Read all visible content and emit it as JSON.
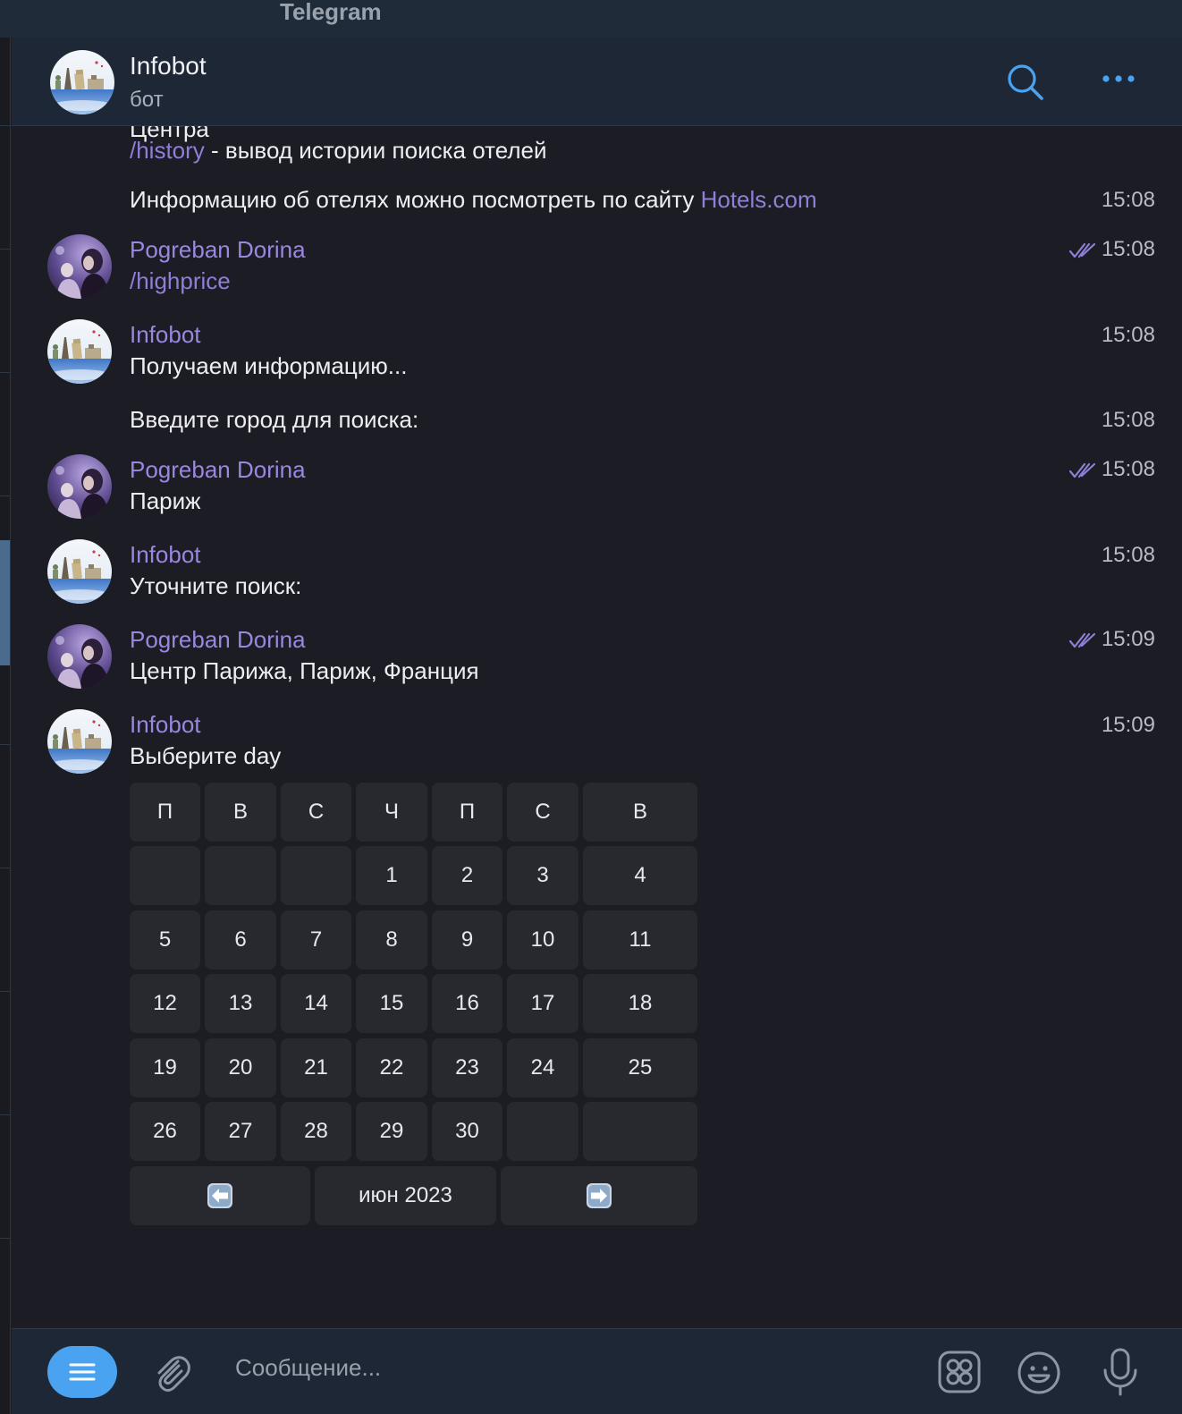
{
  "window": {
    "title": "Telegram"
  },
  "header": {
    "name": "Infobot",
    "status": "бот"
  },
  "messages": {
    "m0_cmd": "/history",
    "m0_rest": " - вывод истории поиска отелей",
    "m1_text": "Информацию об отелях можно посмотреть по сайту ",
    "m1_link": "Hotels.com",
    "m1_time": "15:08",
    "m2_sender": "Pogreban Dorina",
    "m2_text": "/highprice",
    "m2_time": "15:08",
    "m3_sender": "Infobot",
    "m3_text": "Получаем информацию...",
    "m3_time": "15:08",
    "m4_text": "Введите город для поиска:",
    "m4_time": "15:08",
    "m5_sender": "Pogreban Dorina",
    "m5_text": "Париж",
    "m5_time": "15:08",
    "m6_sender": "Infobot",
    "m6_text": "Уточните поиск:",
    "m6_time": "15:08",
    "m7_sender": "Pogreban Dorina",
    "m7_text": "Центр Парижа, Париж, Франция",
    "m7_time": "15:09",
    "m8_sender": "Infobot",
    "m8_text": "Выберите day",
    "m8_time": "15:09"
  },
  "calendar": {
    "weekdays": [
      "П",
      "В",
      "С",
      "Ч",
      "П",
      "С",
      "В"
    ],
    "weeks": [
      [
        "",
        "",
        "",
        "1",
        "2",
        "3",
        "4"
      ],
      [
        "5",
        "6",
        "7",
        "8",
        "9",
        "10",
        "11"
      ],
      [
        "12",
        "13",
        "14",
        "15",
        "16",
        "17",
        "18"
      ],
      [
        "19",
        "20",
        "21",
        "22",
        "23",
        "24",
        "25"
      ],
      [
        "26",
        "27",
        "28",
        "29",
        "30",
        "",
        ""
      ]
    ],
    "month_label": "июн 2023",
    "prev_icon": "left-arrow-emoji",
    "next_icon": "right-arrow-emoji"
  },
  "composer": {
    "placeholder": "Сообщение..."
  },
  "icons": {
    "search": "search-icon",
    "more": "more-dots-icon",
    "menu": "bot-menu-icon",
    "attach": "paperclip-icon",
    "commands": "commands-icon",
    "emoji": "emoji-icon",
    "mic": "microphone-icon"
  },
  "colors": {
    "accent": "#4aa3f0",
    "sender": "#9a87e0",
    "link": "#8f7fd6",
    "background": "#1c1c24",
    "header": "#1d2735",
    "button": "#28282f"
  }
}
